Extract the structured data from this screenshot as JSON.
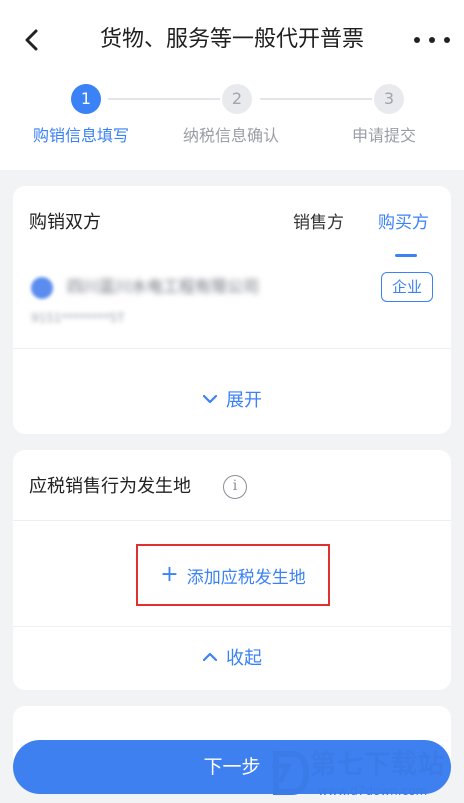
{
  "header": {
    "title": "货物、服务等一般代开普票"
  },
  "steps": [
    {
      "number": "1",
      "label": "购销信息填写",
      "active": true
    },
    {
      "number": "2",
      "label": "纳税信息确认",
      "active": false
    },
    {
      "number": "3",
      "label": "申请提交",
      "active": false
    }
  ],
  "parties": {
    "title": "购销双方",
    "tab_seller": "销售方",
    "tab_buyer": "购买方",
    "company_name": "四川蓝川水电工程有限公司",
    "company_code": "9151********5T",
    "badge": "企业",
    "expand_label": "展开"
  },
  "place": {
    "title": "应税销售行为发生地",
    "info_icon": "i",
    "add_label": "添加应税发生地",
    "add_icon": "+",
    "collapse_label": "收起"
  },
  "footer": {
    "next_label": "下一步"
  },
  "watermark": {
    "text": "第七下载站",
    "url": "www.d7down.com"
  },
  "colors": {
    "accent": "#3b82f6",
    "highlight_border": "#e0302f",
    "background": "#f2f3f5"
  }
}
